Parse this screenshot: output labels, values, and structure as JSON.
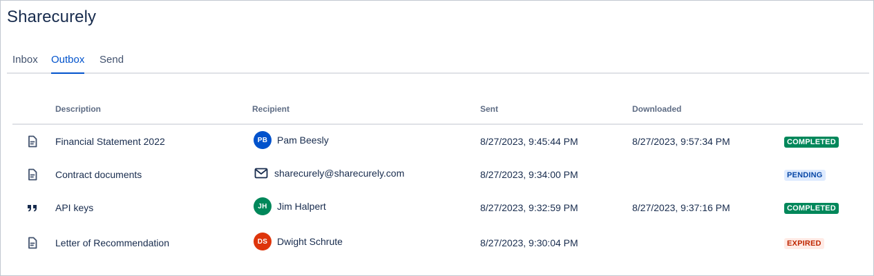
{
  "app": {
    "title": "Sharecurely"
  },
  "tabs": [
    {
      "label": "Inbox",
      "active": false
    },
    {
      "label": "Outbox",
      "active": true
    },
    {
      "label": "Send",
      "active": false
    }
  ],
  "table": {
    "headers": {
      "description": "Description",
      "recipient": "Recipient",
      "sent": "Sent",
      "downloaded": "Downloaded"
    },
    "rows": [
      {
        "icon": "document-icon",
        "description": "Financial Statement 2022",
        "recipient": {
          "type": "user",
          "initials": "PB",
          "name": "Pam Beesly",
          "avatar_color": "#0052cc"
        },
        "sent": "8/27/2023, 9:45:44 PM",
        "downloaded": "8/27/2023, 9:57:34 PM",
        "status": {
          "label": "COMPLETED",
          "bg": "#00875a",
          "fg": "#ffffff"
        }
      },
      {
        "icon": "document-icon",
        "description": "Contract documents",
        "recipient": {
          "type": "email",
          "name": "sharecurely@sharecurely.com"
        },
        "sent": "8/27/2023, 9:34:00 PM",
        "downloaded": "",
        "status": {
          "label": "PENDING",
          "bg": "#deebff",
          "fg": "#0747a6"
        }
      },
      {
        "icon": "quote-icon",
        "description": "API keys",
        "recipient": {
          "type": "user",
          "initials": "JH",
          "name": "Jim Halpert",
          "avatar_color": "#00875a"
        },
        "sent": "8/27/2023, 9:32:59 PM",
        "downloaded": "8/27/2023, 9:37:16 PM",
        "status": {
          "label": "COMPLETED",
          "bg": "#00875a",
          "fg": "#ffffff"
        }
      },
      {
        "icon": "document-icon",
        "description": "Letter of Recommendation",
        "recipient": {
          "type": "user",
          "initials": "DS",
          "name": "Dwight Schrute",
          "avatar_color": "#de350b"
        },
        "sent": "8/27/2023, 9:30:04 PM",
        "downloaded": "",
        "status": {
          "label": "EXPIRED",
          "bg": "#ffebe6",
          "fg": "#bf2600"
        }
      }
    ]
  }
}
